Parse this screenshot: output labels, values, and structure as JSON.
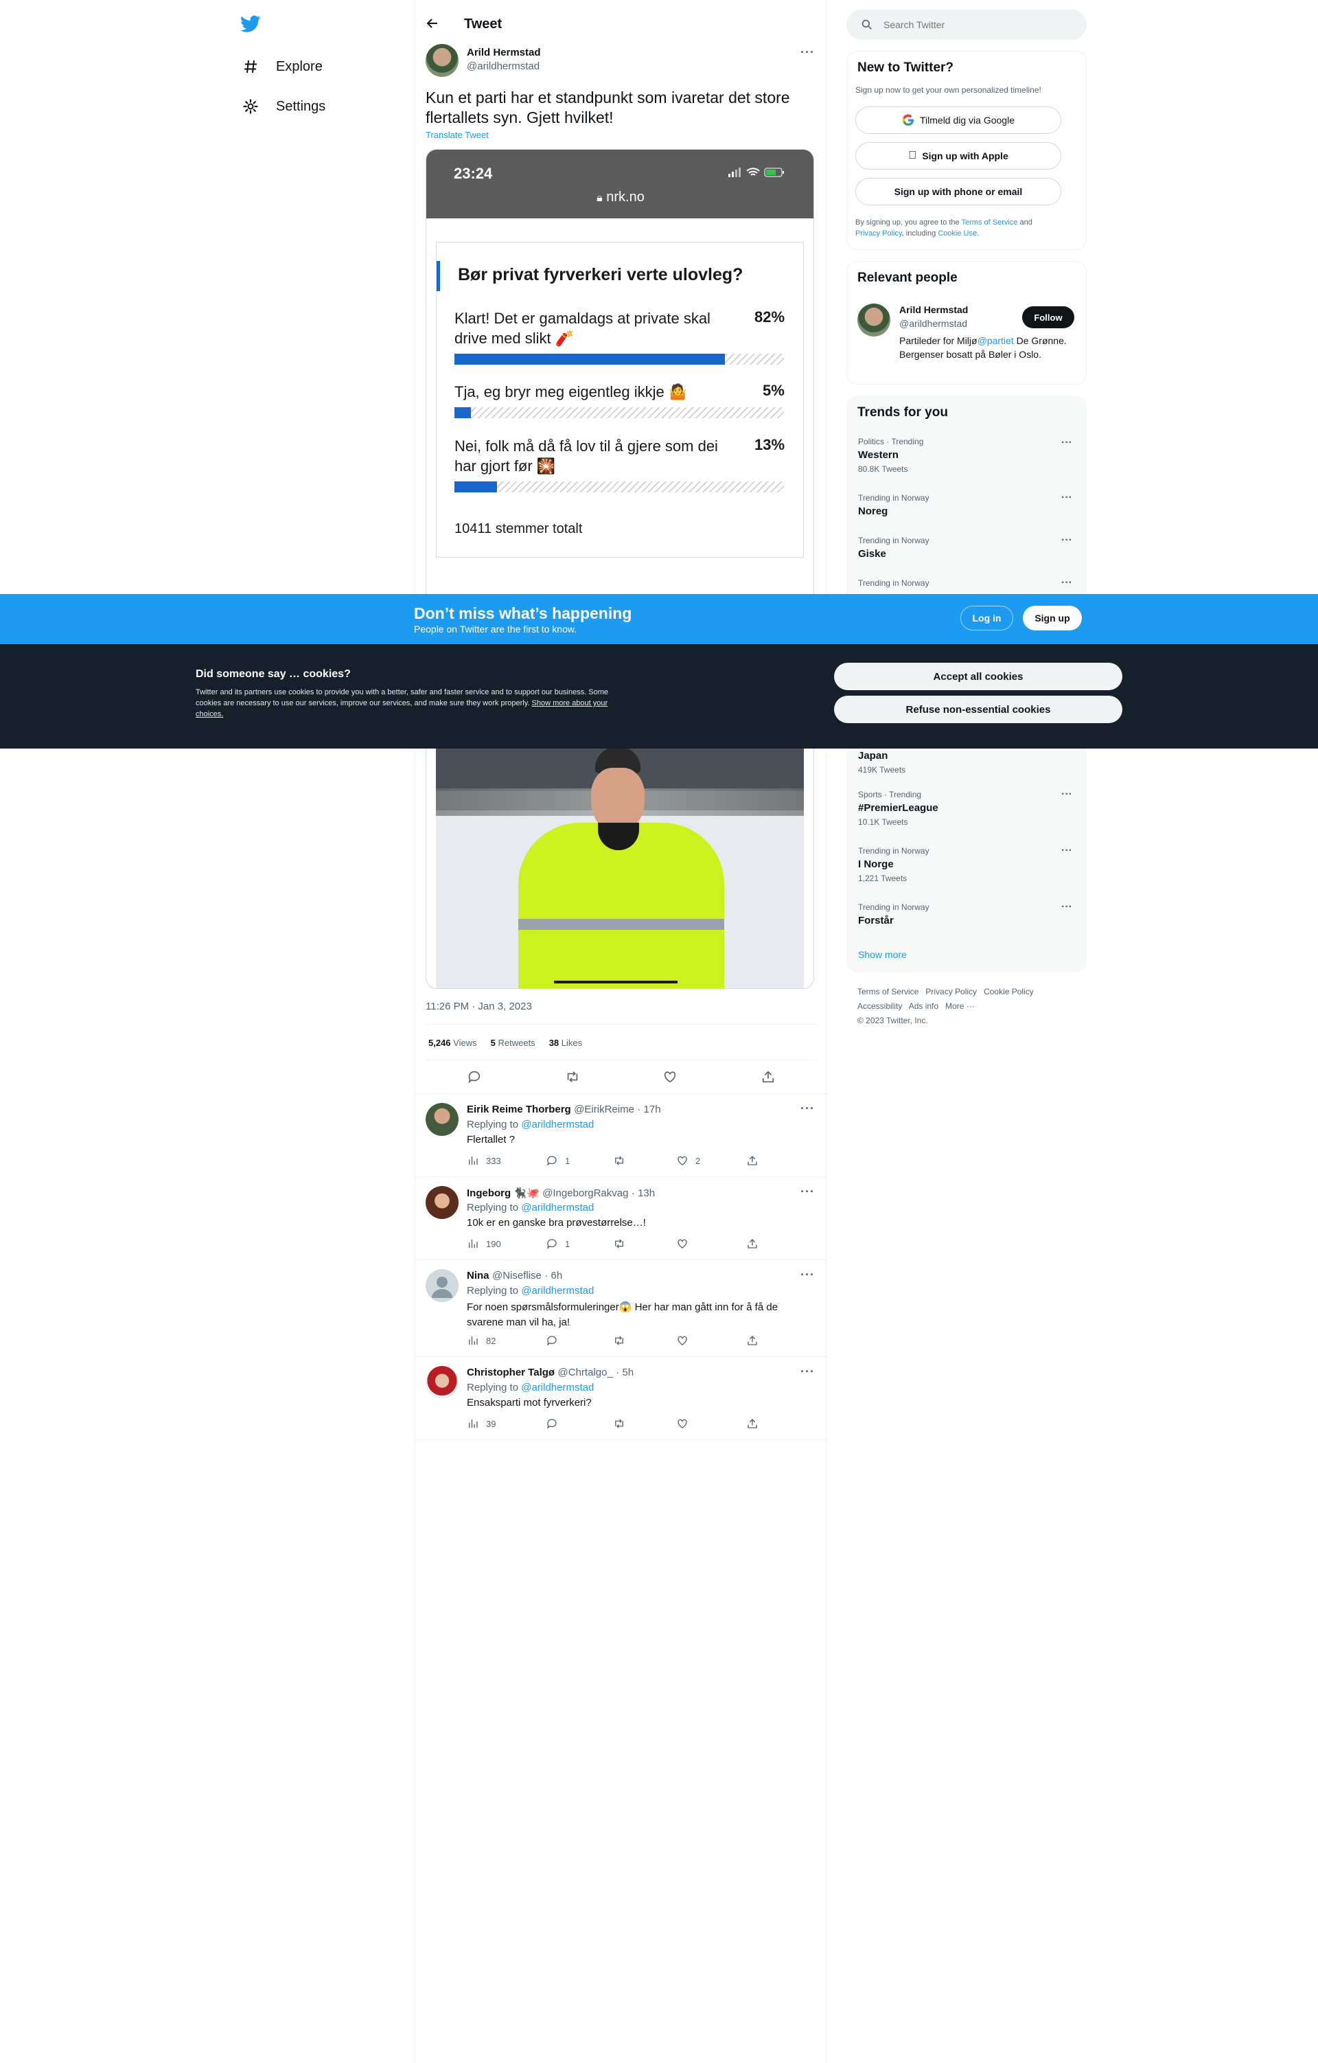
{
  "nav": {
    "explore": "Explore",
    "settings": "Settings"
  },
  "header": {
    "title": "Tweet"
  },
  "tweet": {
    "author": "Arild Hermstad",
    "handle": "@arildhermstad",
    "text": "Kun et parti har et standpunkt som ivaretar det store flertallets syn. Gjett hvilket!",
    "translate": "Translate Tweet",
    "timestamp": "11:26 PM · Jan 3, 2023",
    "views_count": "5,246",
    "views_label": "Views",
    "retweets_count": "5",
    "retweets_label": "Retweets",
    "likes_count": "38",
    "likes_label": "Likes"
  },
  "phone": {
    "time": "23:24",
    "url": "nrk.no"
  },
  "poll": {
    "title": "Bør privat fyrverkeri verte ulovleg?",
    "options": [
      {
        "label": "Klart! Det er gamaldags at private skal drive med slikt 🧨",
        "pct_text": "82%",
        "fraction": 0.82
      },
      {
        "label": "Tja, eg bryr meg eigentleg ikkje 🤷",
        "pct_text": "5%",
        "fraction": 0.05
      },
      {
        "label": "Nei, folk må då få lov til å gjere som dei har gjort før 🎇",
        "pct_text": "13%",
        "fraction": 0.13
      }
    ],
    "total": "10411 stemmer totalt"
  },
  "search": {
    "placeholder": "Search Twitter"
  },
  "new_to_twitter": {
    "title": "New to Twitter?",
    "subtitle": "Sign up now to get your own personalized timeline!",
    "google": "Tilmeld dig via Google",
    "apple": "Sign up with Apple",
    "phone_email": "Sign up with phone or email",
    "legal_1": "By signing up, you agree to the ",
    "tos": "Terms of Service",
    "and": " and",
    "privacy": "Privacy Policy",
    "including": ", including ",
    "cookie_use": "Cookie Use."
  },
  "relevant": {
    "title": "Relevant people",
    "name": "Arild Hermstad",
    "handle": "@arildhermstad",
    "follow": "Follow",
    "bio_1": "Partileder for Miljø",
    "bio_link": "@partiet",
    "bio_2": " De Grønne. Bergenser bosatt på Bøler i Oslo."
  },
  "trends": {
    "title": "Trends for you",
    "items": [
      {
        "category": "Politics · Trending",
        "name": "Western",
        "count": "80.8K Tweets"
      },
      {
        "category": "Trending in Norway",
        "name": "Noreg",
        "count": ""
      },
      {
        "category": "Trending in Norway",
        "name": "Giske",
        "count": ""
      },
      {
        "category": "Trending in Norway",
        "name": "",
        "count": ""
      },
      {
        "category": "",
        "name": "Japan",
        "count": "419K Tweets"
      },
      {
        "category": "Sports · Trending",
        "name": "#PremierLeague",
        "count": "10.1K Tweets"
      },
      {
        "category": "Trending in Norway",
        "name": "I Norge",
        "count": "1,221 Tweets"
      },
      {
        "category": "Trending in Norway",
        "name": "Forstår",
        "count": ""
      }
    ],
    "show_more": "Show more"
  },
  "footer": {
    "tos": "Terms of Service",
    "privacy": "Privacy Policy",
    "cookie": "Cookie Policy",
    "accessibility": "Accessibility",
    "ads": "Ads info",
    "more": "More ···",
    "copyright": "© 2023 Twitter, Inc."
  },
  "replies": [
    {
      "name": "Eirik Reime Thorberg",
      "handle": "@EirikReime",
      "time": "· 17h",
      "replying": "Replying to ",
      "to": "@arildhermstad",
      "text": "Flertallet ?",
      "views": "333",
      "replies": "1",
      "retweets": "",
      "likes": "2"
    },
    {
      "name": "Ingeborg 🐈‍⬛🐙",
      "handle": "@IngeborgRakvag",
      "time": "· 13h",
      "replying": "Replying to ",
      "to": "@arildhermstad",
      "text": "10k er en ganske bra prøvestørrelse…!",
      "views": "190",
      "replies": "1",
      "retweets": "",
      "likes": ""
    },
    {
      "name": "Nina",
      "handle": "@Niseflise",
      "time": "· 6h",
      "replying": "Replying to ",
      "to": "@arildhermstad",
      "text": "For noen spørsmålsformuleringer😱 Her har man gått inn for å få de svarene man vil ha, ja!",
      "views": "82",
      "replies": "",
      "retweets": "",
      "likes": ""
    },
    {
      "name": "Christopher Talgø",
      "handle": "@Chrtalgo_",
      "time": "· 5h",
      "replying": "Replying to ",
      "to": "@arildhermstad",
      "text": "Ensaksparti mot fyrverkeri?",
      "views": "39",
      "replies": "",
      "retweets": "",
      "likes": ""
    }
  ],
  "banner": {
    "title": "Don’t miss what’s happening",
    "subtitle": "People on Twitter are the first to know.",
    "login": "Log in",
    "signup": "Sign up"
  },
  "cookies": {
    "title": "Did someone say … cookies?",
    "body": "Twitter and its partners use cookies to provide you with a better, safer and faster service and to support our business. Some cookies are necessary to use our services, improve our services, and make sure they work properly. ",
    "link": "Show more about your choices.",
    "accept": "Accept all cookies",
    "refuse": "Refuse non-essential cookies"
  },
  "colors": {
    "accent": "#1d9bf0",
    "poll_bar": "#1767ce",
    "cookie_bg": "#15202b"
  }
}
